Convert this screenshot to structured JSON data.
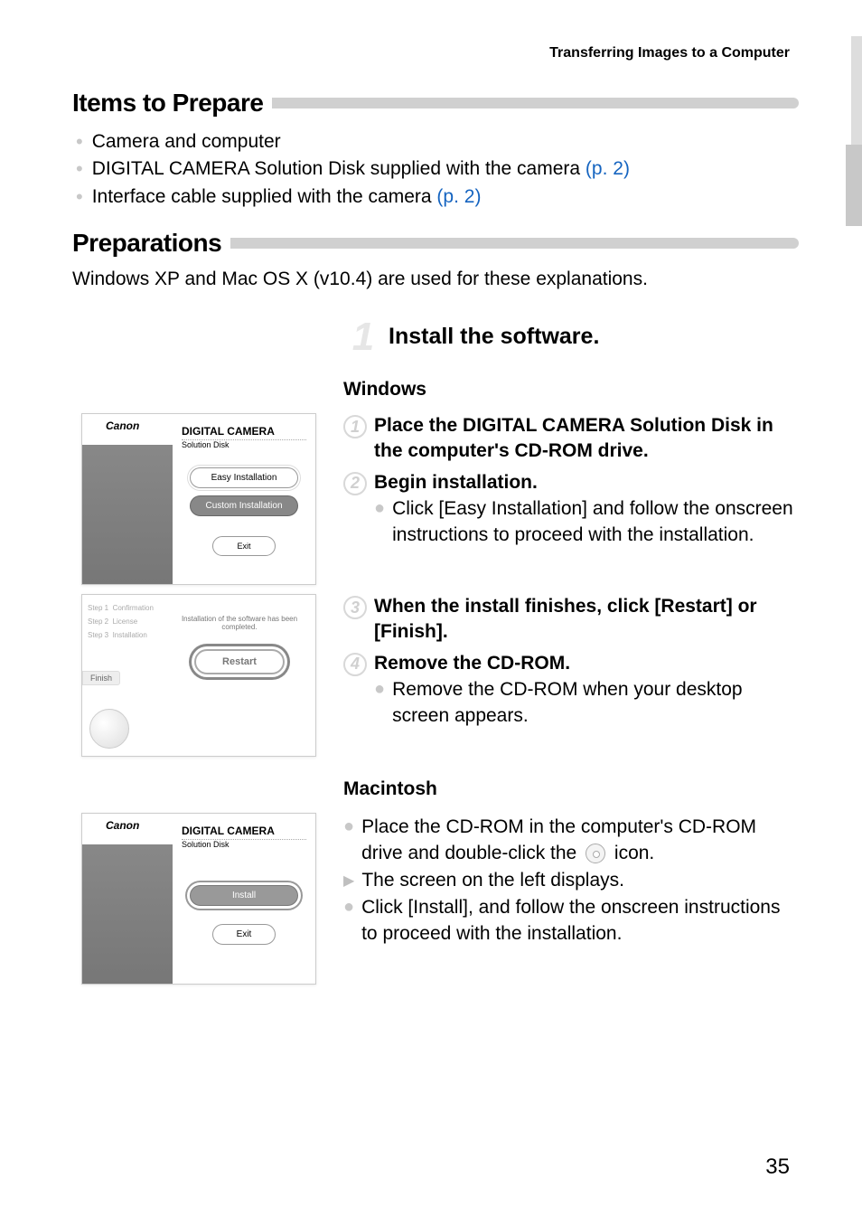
{
  "header": {
    "title": "Transferring Images to a Computer"
  },
  "sections": {
    "items_heading": "Items to Prepare",
    "preps_heading": "Preparations"
  },
  "items": [
    {
      "text": "Camera and computer"
    },
    {
      "text": "DIGITAL CAMERA Solution Disk supplied with the camera ",
      "link": "(p. 2)"
    },
    {
      "text": "Interface cable supplied with the camera ",
      "link": "(p. 2)"
    }
  ],
  "prep_intro": "Windows XP and Mac OS X (v10.4) are used for these explanations.",
  "main_step": {
    "num": "1",
    "title": "Install the software."
  },
  "subheads": {
    "windows": "Windows",
    "mac": "Macintosh"
  },
  "win_steps": [
    {
      "n": "1",
      "title": "Place the DIGITAL CAMERA Solution Disk in the computer's CD-ROM drive."
    },
    {
      "n": "2",
      "title": "Begin installation.",
      "body": "Click [Easy Installation] and follow the onscreen instructions to proceed with the installation."
    },
    {
      "n": "3",
      "title": "When the install finishes, click [Restart] or [Finish]."
    },
    {
      "n": "4",
      "title": "Remove the CD-ROM.",
      "body": "Remove the CD-ROM when your desktop screen appears."
    }
  ],
  "mac_steps": {
    "line1a": "Place the CD-ROM in the computer's CD-ROM drive and double-click the ",
    "line1b": " icon.",
    "line2": "The screen on the left displays.",
    "line3": "Click [Install], and follow the onscreen instructions to proceed with the installation."
  },
  "screenshots": {
    "brand": "DIGITAL CAMERA",
    "subtitle": "Solution Disk",
    "easy": "Easy Installation",
    "custom": "Custom Installation",
    "exit": "Exit",
    "install": "Install",
    "restart": "Restart",
    "finish_tab": "Finish",
    "completed": "Installation of the software has been completed."
  },
  "page_number": "35"
}
